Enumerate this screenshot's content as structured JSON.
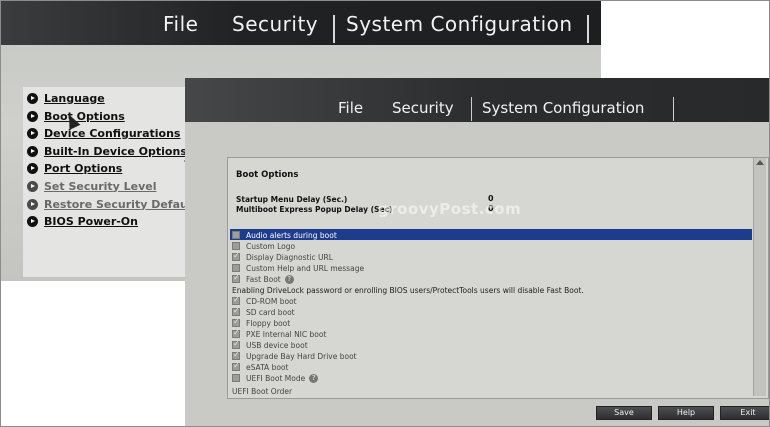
{
  "back_screen": {
    "menu": [
      "File",
      "Security",
      "System Configuration"
    ],
    "items": [
      {
        "label": "Language",
        "enabled": true
      },
      {
        "label": "Boot Options",
        "enabled": true
      },
      {
        "label": "Device Configurations",
        "enabled": true
      },
      {
        "label": "Built-In Device Options",
        "enabled": true
      },
      {
        "label": "Port Options",
        "enabled": true
      },
      {
        "label": "Set Security Level",
        "enabled": false
      },
      {
        "label": "Restore Security Defaults",
        "enabled": false
      },
      {
        "label": "BIOS Power-On",
        "enabled": true
      }
    ]
  },
  "front_screen": {
    "menu": [
      "File",
      "Security",
      "System Configuration"
    ],
    "panel_title": "Boot Options",
    "startup_delay": {
      "label": "Startup Menu Delay (Sec.)",
      "value": "0"
    },
    "multiboot_delay": {
      "label": "Multiboot Express Popup Delay (Sec)",
      "value": "0"
    },
    "watermark": "groovyPost.com",
    "options": [
      {
        "label": "Audio alerts during boot",
        "checked": false,
        "selected": true
      },
      {
        "label": "Custom Logo",
        "checked": false
      },
      {
        "label": "Display Diagnostic URL",
        "checked": true
      },
      {
        "label": "Custom Help and URL message",
        "checked": false
      },
      {
        "label": "Fast Boot",
        "checked": true,
        "help": true
      },
      {
        "label": "Enabling DriveLock password or enrolling BIOS users/ProtectTools users will disable Fast Boot.",
        "note": true
      },
      {
        "label": "CD-ROM boot",
        "checked": true
      },
      {
        "label": "SD card boot",
        "checked": true
      },
      {
        "label": "Floppy boot",
        "checked": true
      },
      {
        "label": "PXE Internal NIC boot",
        "checked": true
      },
      {
        "label": "USB device boot",
        "checked": true
      },
      {
        "label": "Upgrade Bay Hard Drive boot",
        "checked": true
      },
      {
        "label": "eSATA boot",
        "checked": true
      },
      {
        "label": "UEFI Boot Mode",
        "checked": false,
        "help": true
      },
      {
        "label": "UEFI Boot Order",
        "note": true
      }
    ],
    "help_glyph": "?",
    "buttons": {
      "save": "Save",
      "help": "Help",
      "exit": "Exit"
    }
  }
}
